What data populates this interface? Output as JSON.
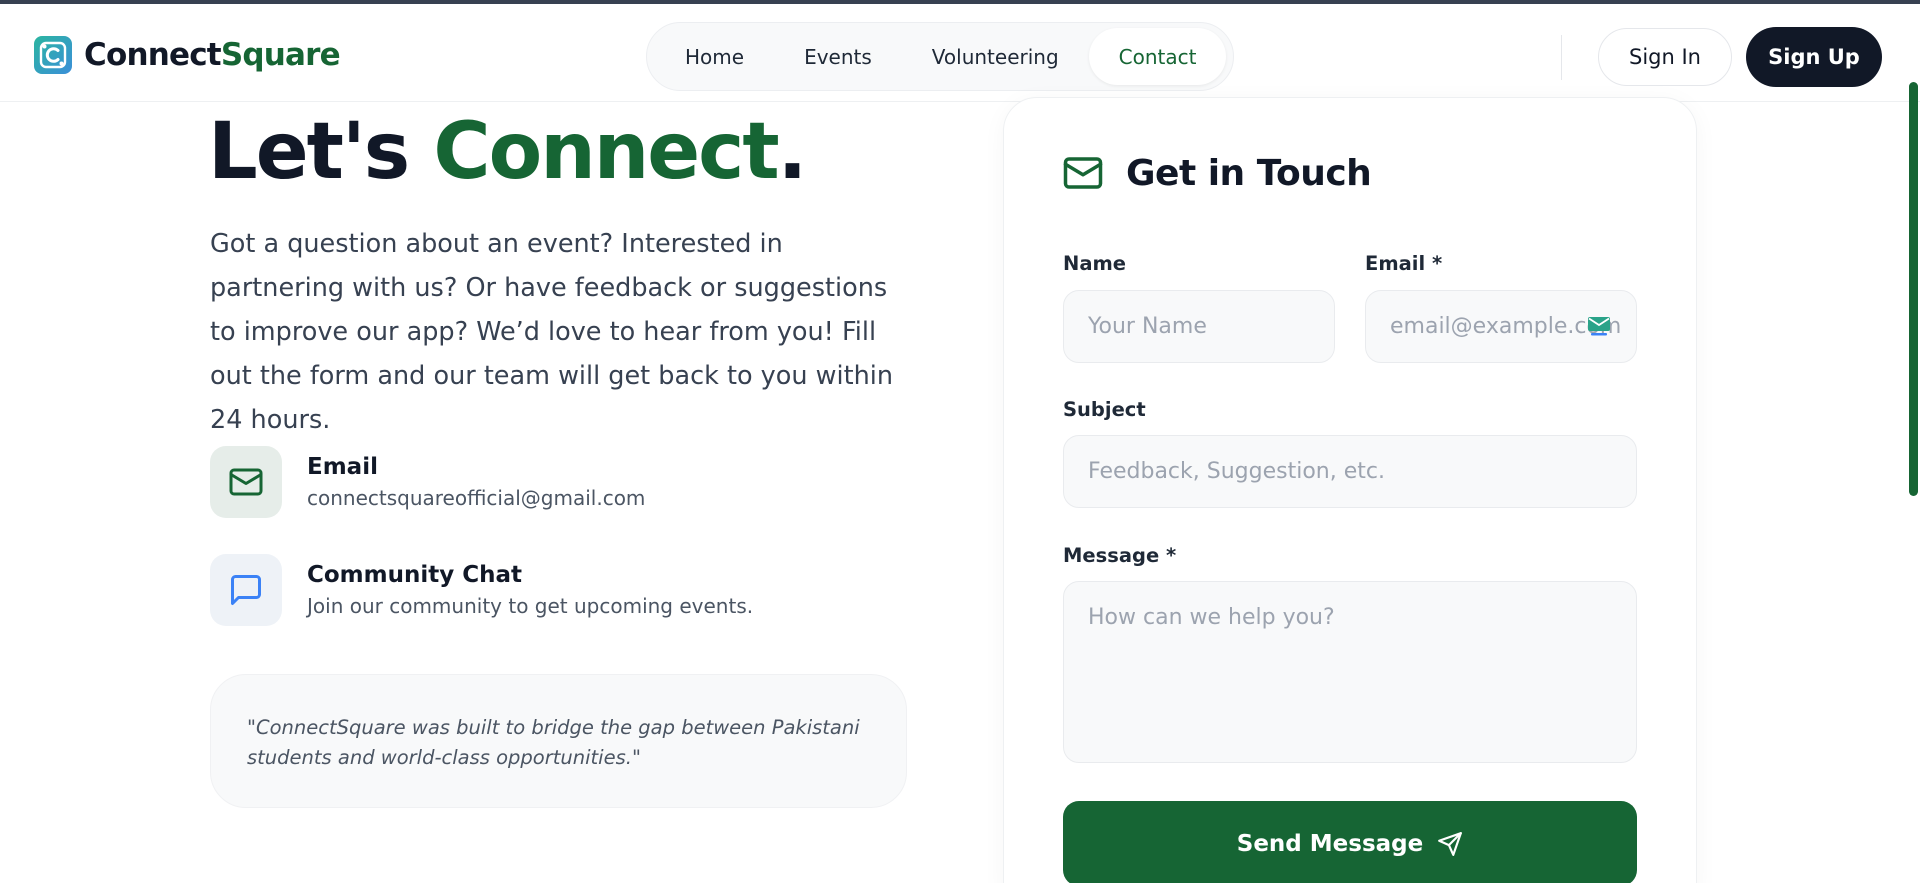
{
  "brand": {
    "name_part1": "Connect",
    "name_part2": "Square",
    "logo_icon": "logo-icon"
  },
  "nav": {
    "items": [
      {
        "label": "Home"
      },
      {
        "label": "Events"
      },
      {
        "label": "Volunteering"
      },
      {
        "label": "Contact",
        "active": true
      }
    ]
  },
  "auth": {
    "signin_label": "Sign In",
    "signup_label": "Sign Up"
  },
  "hero": {
    "title_part1": "Let's ",
    "title_part2": "Connect",
    "title_part3": ".",
    "intro": "Got a question about an event? Interested in partnering with us? Or have feedback or suggestions to improve our app? We’d love to hear from you! Fill out the form and our team will get back to you within 24 hours."
  },
  "contacts": [
    {
      "title": "Email",
      "subtitle": "connectsquareofficial@gmail.com",
      "icon": "mail-icon"
    },
    {
      "title": "Community Chat",
      "subtitle": "Join our community to get upcoming events.",
      "icon": "chat-icon"
    }
  ],
  "quote": "\"ConnectSquare was built to bridge the gap between Pakistani students and world-class opportunities.\"",
  "form": {
    "title": "Get in Touch",
    "title_icon": "mail-icon",
    "name_label": "Name",
    "name_placeholder": "Your Name",
    "email_label": "Email *",
    "email_placeholder": "email@example.com",
    "subject_label": "Subject",
    "subject_placeholder": "Feedback, Suggestion, etc.",
    "message_label": "Message *",
    "message_placeholder": "How can we help you?",
    "submit_label": "Send Message",
    "submit_icon": "send-icon"
  },
  "colors": {
    "brand_green": "#166534",
    "dark": "#111827",
    "field_bg": "#f8f9fa"
  }
}
